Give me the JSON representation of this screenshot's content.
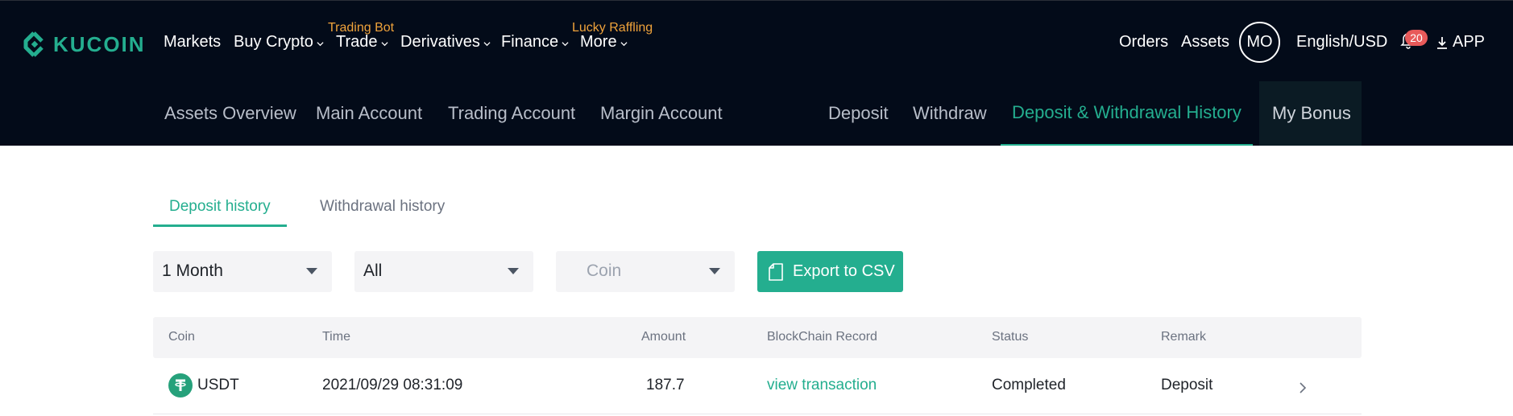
{
  "brand": {
    "name": "KUCOIN",
    "color": "#24ae8f"
  },
  "nav": {
    "markets": "Markets",
    "buy_crypto": "Buy Crypto",
    "trade": "Trade",
    "trade_promo": "Trading Bot",
    "derivatives": "Derivatives",
    "finance": "Finance",
    "more": "More",
    "more_promo": "Lucky Raffling",
    "orders": "Orders",
    "assets": "Assets",
    "avatar_initials": "MO",
    "language": "English/USD",
    "notification_count": "20",
    "app": "APP"
  },
  "subnav": {
    "assets_overview": "Assets Overview",
    "main_account": "Main Account",
    "trading_account": "Trading Account",
    "margin_account": "Margin Account",
    "deposit": "Deposit",
    "withdraw": "Withdraw",
    "history": "Deposit & Withdrawal History",
    "my_bonus": "My Bonus"
  },
  "tabs": {
    "deposit_history": "Deposit history",
    "withdrawal_history": "Withdrawal history"
  },
  "filters": {
    "period": "1 Month",
    "type": "All",
    "coin_placeholder": "Coin",
    "export_label": "Export to CSV"
  },
  "table": {
    "headers": {
      "coin": "Coin",
      "time": "Time",
      "amount": "Amount",
      "blockchain": "BlockChain Record",
      "status": "Status",
      "remark": "Remark"
    },
    "rows": [
      {
        "coin": "USDT",
        "time": "2021/09/29 08:31:09",
        "amount": "187.7",
        "blockchain": "view transaction",
        "status": "Completed",
        "remark": "Deposit"
      }
    ]
  },
  "colors": {
    "nav_bg": "#030b19",
    "accent": "#24ae8f",
    "promo": "#f0a33b",
    "badge": "#e85a5a",
    "usdt": "#26a17b"
  }
}
